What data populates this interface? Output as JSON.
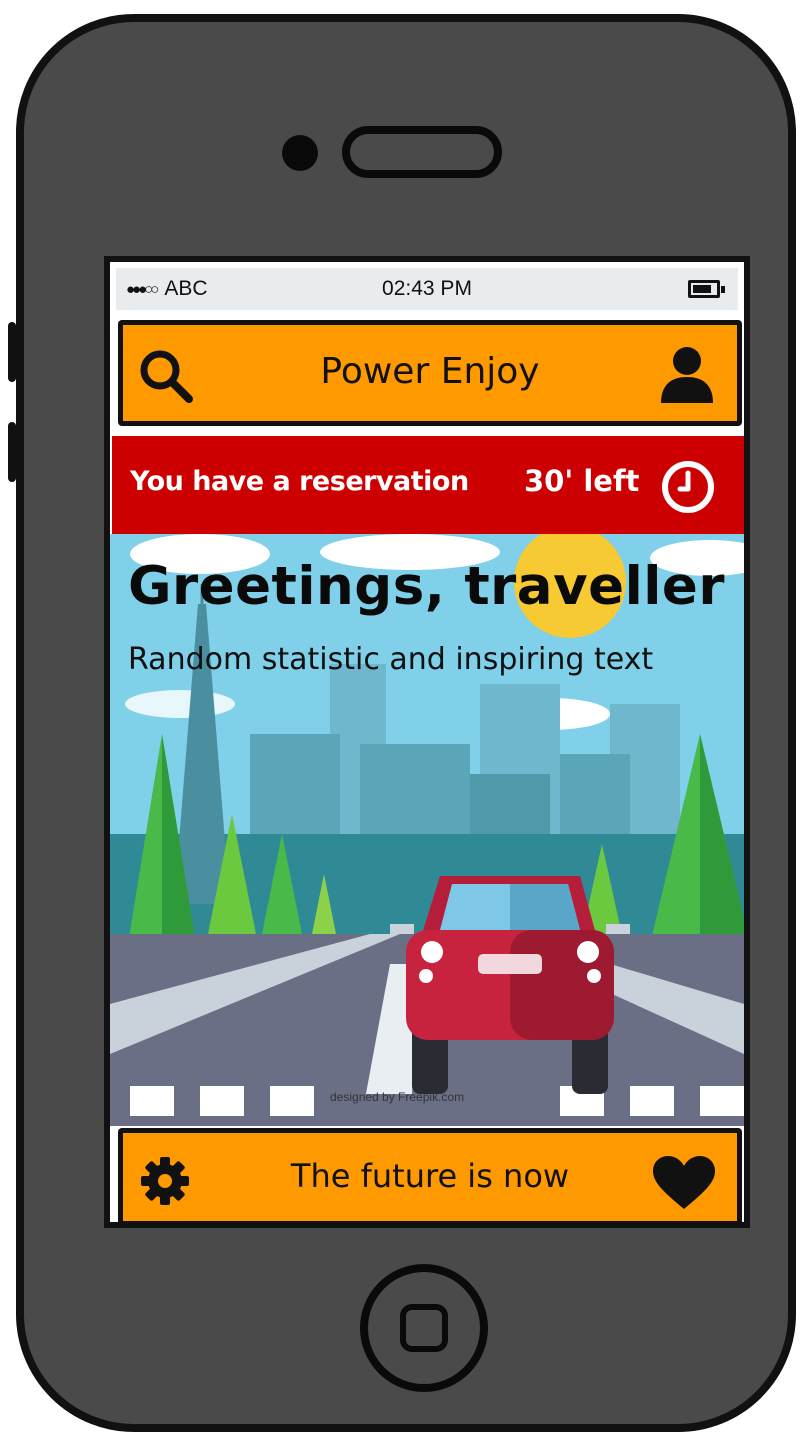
{
  "status_bar": {
    "signal": "●●●○○",
    "carrier": "ABC",
    "time": "02:43 PM",
    "battery_icon": "battery-icon"
  },
  "top_bar": {
    "title": "Power Enjoy",
    "left_icon": "search-icon",
    "right_icon": "user-icon"
  },
  "reservation_banner": {
    "message": "You have a reservation",
    "time_left": "30' left",
    "icon": "clock-icon"
  },
  "hero": {
    "heading": "Greetings, traveller",
    "subtext": "Random statistic and inspiring text",
    "image_credit": "designed by Freepik.com"
  },
  "bottom_bar": {
    "title": "The future is now",
    "left_icon": "gear-icon",
    "right_icon": "heart-icon"
  },
  "colors": {
    "bars": "#ff9900",
    "banner": "#cc0000",
    "phone_body": "#4a4a4a",
    "sky": "#7fd0e8"
  }
}
